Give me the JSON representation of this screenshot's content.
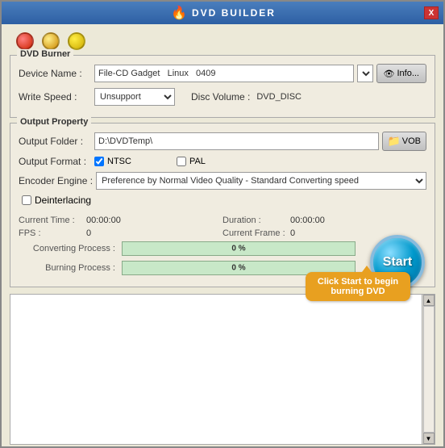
{
  "window": {
    "title": "DVD BUILDER",
    "close_label": "X"
  },
  "traffic_lights": [
    {
      "type": "red",
      "class": "tl-red"
    },
    {
      "type": "yellow",
      "class": "tl-yellow"
    },
    {
      "type": "green",
      "class": "tl-green"
    }
  ],
  "dvd_burner": {
    "section_title": "DVD Burner",
    "device_name_label": "Device Name :",
    "device_name_value": "File-CD Gadget   Linux   0409",
    "info_label": "Info...",
    "write_speed_label": "Write Speed :",
    "write_speed_value": "Unsupport",
    "disc_volume_label": "Disc Volume :",
    "disc_volume_value": "DVD_DISC"
  },
  "output_property": {
    "section_title": "Output Property",
    "output_folder_label": "Output Folder :",
    "output_folder_value": "D:\\DVDTemp\\",
    "vob_label": "VOB",
    "output_format_label": "Output Format :",
    "ntsc_label": "NTSC",
    "pal_label": "PAL",
    "encoder_engine_label": "Encoder Engine :",
    "encoder_value": "Preference by Normal Video Quality - Standard Converting speed",
    "deinterlacing_label": "Deinterlacing"
  },
  "stats": {
    "current_time_label": "Current Time :",
    "current_time_value": "00:00:00",
    "duration_label": "Duration :",
    "duration_value": "00:00:00",
    "fps_label": "FPS :",
    "fps_value": "0",
    "current_frame_label": "Current Frame :",
    "current_frame_value": "0"
  },
  "process": {
    "converting_label": "Converting Process :",
    "converting_pct": "0 %",
    "burning_label": "Burning Process :",
    "burning_pct": "0 %",
    "start_label": "Start",
    "tooltip": "Click Start to begin burning DVD"
  }
}
